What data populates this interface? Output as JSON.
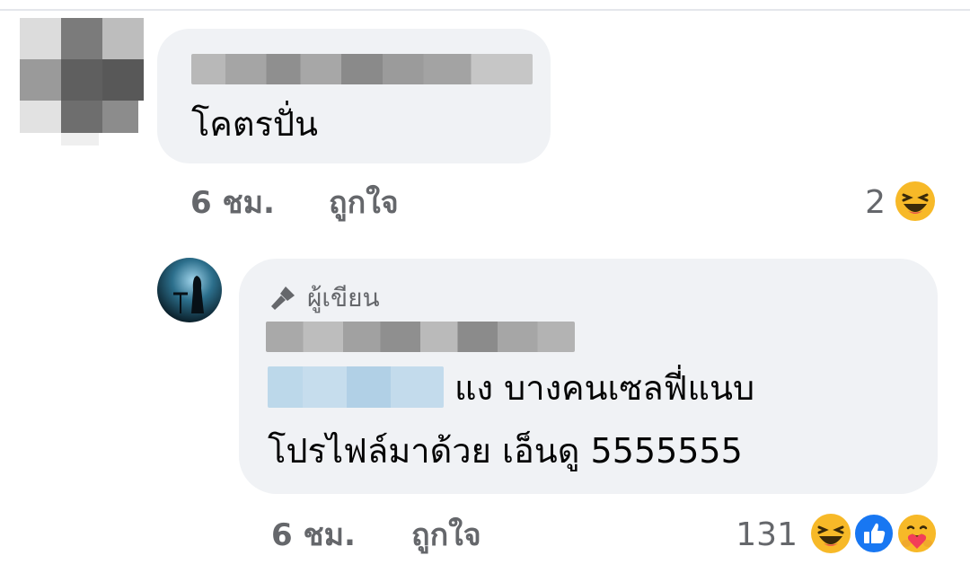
{
  "comments": [
    {
      "text": "โคตรปั่น",
      "time": "6 ชม.",
      "like_label": "ถูกใจ",
      "reaction_count": "2",
      "reactions": [
        "haha-icon"
      ]
    },
    {
      "badge": "ผู้เขียน",
      "text_line1": "แง บางคนเซลฟี่แนบ",
      "text_line2": "โปรไฟล์มาด้วย เอ็นดู 5555555",
      "time": "6 ชม.",
      "like_label": "ถูกใจ",
      "reaction_count": "131",
      "reactions": [
        "haha-icon",
        "like-icon",
        "care-icon"
      ]
    }
  ],
  "colors": {
    "bubble": "#f0f2f5",
    "meta_text": "#65676b",
    "like_blue": "#1877f2",
    "haha_yellow": "#f7b928"
  }
}
